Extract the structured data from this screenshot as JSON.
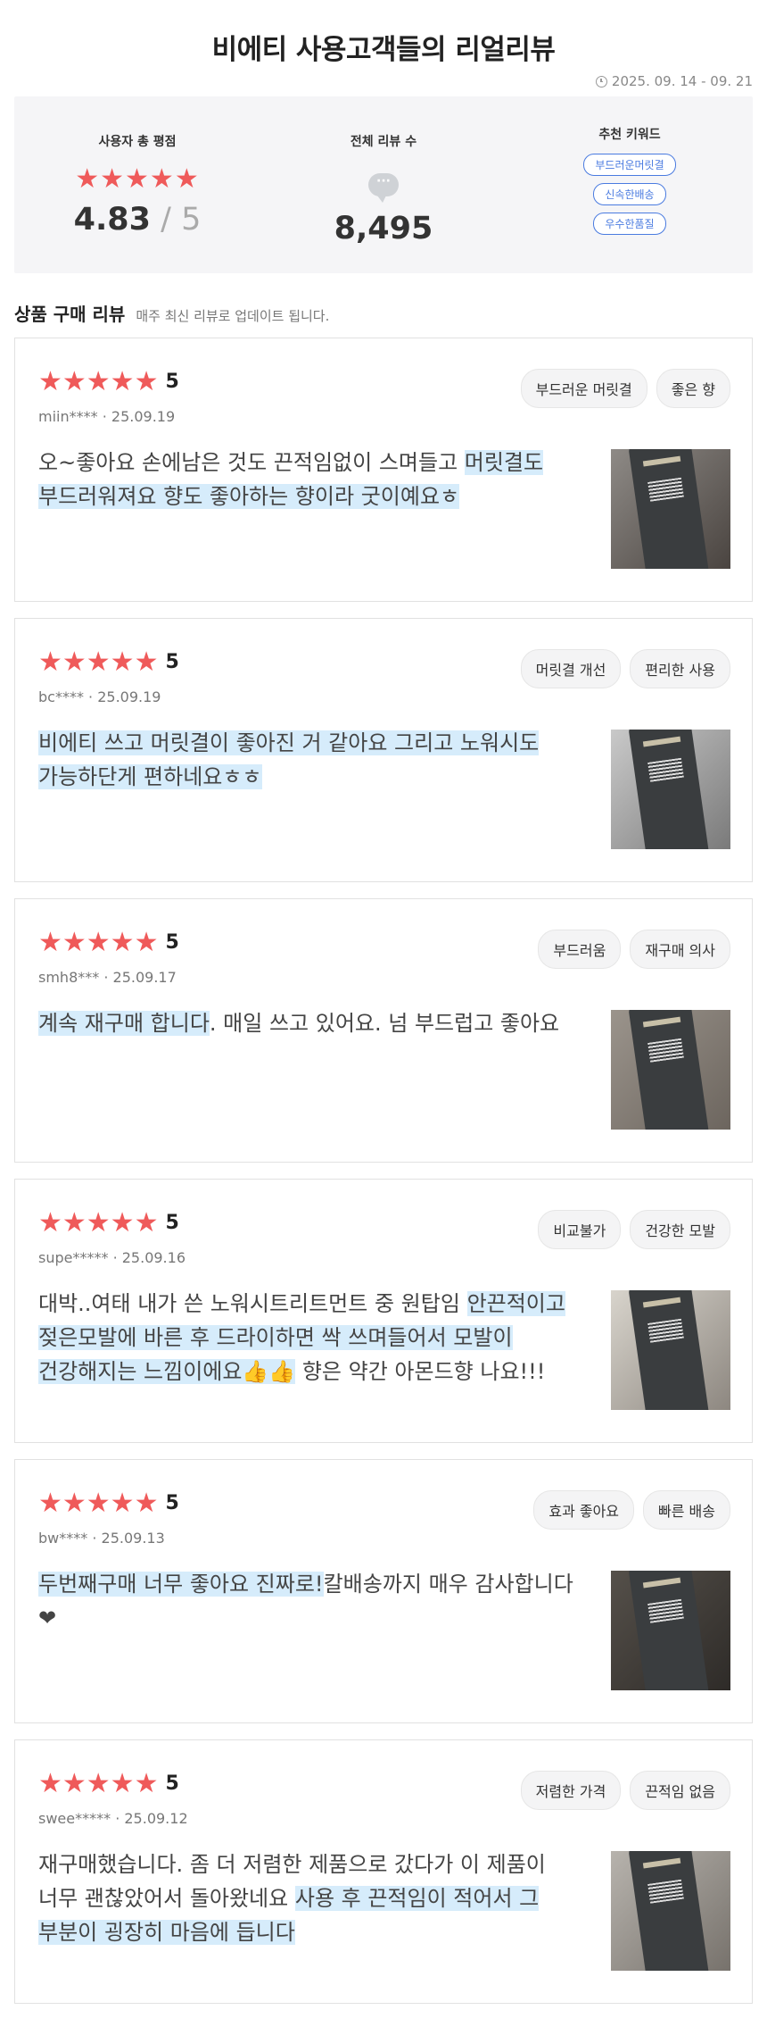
{
  "page": {
    "title": "비에티 사용고객들의 리얼리뷰",
    "date_range": "2025. 09. 14 - 09. 21"
  },
  "summary": {
    "rating_label": "사용자 총 평점",
    "rating_stars": "★★★★★",
    "rating_value": "4.83",
    "rating_slash": " / ",
    "rating_max": "5",
    "review_count_label": "전체 리뷰 수",
    "review_count": "8,495",
    "keywords_label": "추천 키워드",
    "keywords": [
      "부드러운머릿결",
      "신속한배송",
      "우수한품질"
    ]
  },
  "section": {
    "title": "상품 구매 리뷰",
    "subtitle": "매주 최신 리뷰로 업데이트 됩니다."
  },
  "reviews": [
    {
      "stars": "★★★★★",
      "score": "5",
      "user": "miin****",
      "date": "25.09.19",
      "tags": [
        "부드러운 머릿결",
        "좋은 향"
      ],
      "text_plain": "오~좋아요 손에남은 것도 끈적임없이 스며들고 ",
      "text_highlight": "머릿결도 부드러워져요 향도 좋아하는 향이라 굿이예요ㅎ",
      "text_after": ""
    },
    {
      "stars": "★★★★★",
      "score": "5",
      "user": "bc****",
      "date": "25.09.19",
      "tags": [
        "머릿결 개선",
        "편리한 사용"
      ],
      "text_plain": "",
      "text_highlight": "비에티 쓰고 머릿결이 좋아진 거 같아요 그리고 노워시도 가능하단게 편하네요ㅎㅎ",
      "text_after": ""
    },
    {
      "stars": "★★★★★",
      "score": "5",
      "user": "smh8***",
      "date": "25.09.17",
      "tags": [
        "부드러움",
        "재구매 의사"
      ],
      "text_plain": "",
      "text_highlight": "계속 재구매 합니다",
      "text_after": ". 매일 쓰고 있어요. 넘 부드럽고 좋아요"
    },
    {
      "stars": "★★★★★",
      "score": "5",
      "user": "supe*****",
      "date": "25.09.16",
      "tags": [
        "비교불가",
        "건강한 모발"
      ],
      "text_plain": "대박..여태 내가 쓴 노워시트리트먼트 중 원탑임 ",
      "text_highlight": "안끈적이고 젖은모발에 바른 후 드라이하면 싹 쓰며들어서 모발이 건강해지는 느낌이에요👍👍",
      "text_after": " 향은 약간 아몬드향 나요!!!"
    },
    {
      "stars": "★★★★★",
      "score": "5",
      "user": "bw****",
      "date": "25.09.13",
      "tags": [
        "효과 좋아요",
        "빠른 배송"
      ],
      "text_plain": "",
      "text_highlight": "두번째구매 너무 좋아요 진짜로!",
      "text_after": "칼배송까지 매우 감사합니다❤"
    },
    {
      "stars": "★★★★★",
      "score": "5",
      "user": "swee*****",
      "date": "25.09.12",
      "tags": [
        "저렴한 가격",
        "끈적임 없음"
      ],
      "text_plain": "재구매했습니다. 좀 더 저렴한 제품으로 갔다가 이 제품이 너무 괜찮았어서 돌아왔네요 ",
      "text_highlight": "사용 후 끈적임이 적어서 그 부분이 굉장히 마음에 듭니다",
      "text_after": ""
    }
  ],
  "colors": {
    "star": "#ef5a5a",
    "keyword": "#4a7be0",
    "highlight": "#d6ecfb",
    "summary_bg": "#f5f5f7"
  }
}
